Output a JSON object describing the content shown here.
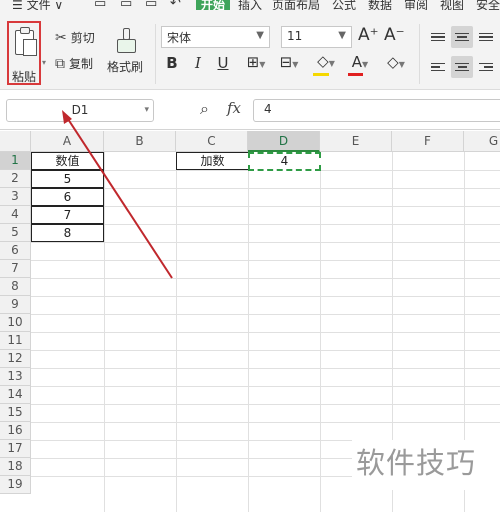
{
  "menubar": {
    "items": [
      {
        "label": "☰ 文件 ∨"
      },
      {
        "label": "开始"
      },
      {
        "label": "插入"
      },
      {
        "label": "页面布局"
      },
      {
        "label": "公式"
      },
      {
        "label": "数据"
      },
      {
        "label": "审阅"
      },
      {
        "label": "视图"
      },
      {
        "label": "安全"
      }
    ]
  },
  "ribbon": {
    "paste_label": "粘贴",
    "cut_label": "剪切",
    "copy_label": "复制",
    "format_painter_label": "格式刷",
    "font_name": "宋体",
    "font_size": "11",
    "bold_label": "B",
    "italic_label": "I",
    "underline_label": "U",
    "grow_font_label": "A⁺",
    "shrink_font_label": "A⁻",
    "font_color_label": "A",
    "accent_color": "#3ea45a",
    "highlight_color": "#f5d800",
    "font_color": "#e02020"
  },
  "formula_bar": {
    "cell_ref": "D1",
    "fx_label": "fx",
    "value": "4"
  },
  "sheet": {
    "columns": [
      "A",
      "B",
      "C",
      "D",
      "E",
      "F",
      "G"
    ],
    "rows": [
      "1",
      "2",
      "3",
      "4",
      "5",
      "6",
      "7",
      "8",
      "9",
      "10",
      "11",
      "12",
      "13",
      "14",
      "15",
      "16",
      "17",
      "18",
      "19"
    ],
    "cells": {
      "A1": "数值",
      "A2": "5",
      "A3": "6",
      "A4": "7",
      "A5": "8",
      "C1": "加数",
      "D1": "4"
    },
    "selected_cell": "D1",
    "selection_color": "#2f9c45"
  },
  "watermark": {
    "text": "软件技巧"
  },
  "annotation": {
    "arrow_color": "#c0282d"
  }
}
